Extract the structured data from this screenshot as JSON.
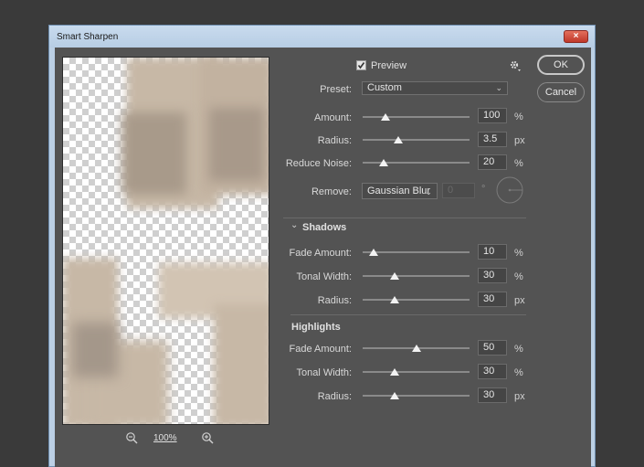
{
  "window": {
    "title": "Smart Sharpen",
    "close": "×"
  },
  "preview": {
    "zoom": "100%",
    "zoom_out_icon": "zoom-out-icon",
    "zoom_in_icon": "zoom-in-icon"
  },
  "top": {
    "preview_label": "Preview",
    "preview_checked": true,
    "gear_icon": "gear-icon"
  },
  "buttons": {
    "ok": "OK",
    "cancel": "Cancel"
  },
  "preset": {
    "label": "Preset:",
    "value": "Custom"
  },
  "sharpen": {
    "amount": {
      "label": "Amount:",
      "value": "100",
      "unit": "%",
      "level": 0.21
    },
    "radius": {
      "label": "Radius:",
      "value": "3.5",
      "unit": "px",
      "level": 0.33
    },
    "noise": {
      "label": "Reduce Noise:",
      "value": "20",
      "unit": "%",
      "level": 0.2
    }
  },
  "remove": {
    "label": "Remove:",
    "value": "Gaussian Blur",
    "angle": "0",
    "angle_unit": "°"
  },
  "shadows": {
    "title": "Shadows",
    "fade": {
      "label": "Fade Amount:",
      "value": "10",
      "unit": "%",
      "level": 0.1
    },
    "tonal": {
      "label": "Tonal Width:",
      "value": "30",
      "unit": "%",
      "level": 0.3
    },
    "radius": {
      "label": "Radius:",
      "value": "30",
      "unit": "px",
      "level": 0.3
    }
  },
  "highlights": {
    "title": "Highlights",
    "fade": {
      "label": "Fade Amount:",
      "value": "50",
      "unit": "%",
      "level": 0.5
    },
    "tonal": {
      "label": "Tonal Width:",
      "value": "30",
      "unit": "%",
      "level": 0.3
    },
    "radius": {
      "label": "Radius:",
      "value": "30",
      "unit": "px",
      "level": 0.3
    }
  }
}
